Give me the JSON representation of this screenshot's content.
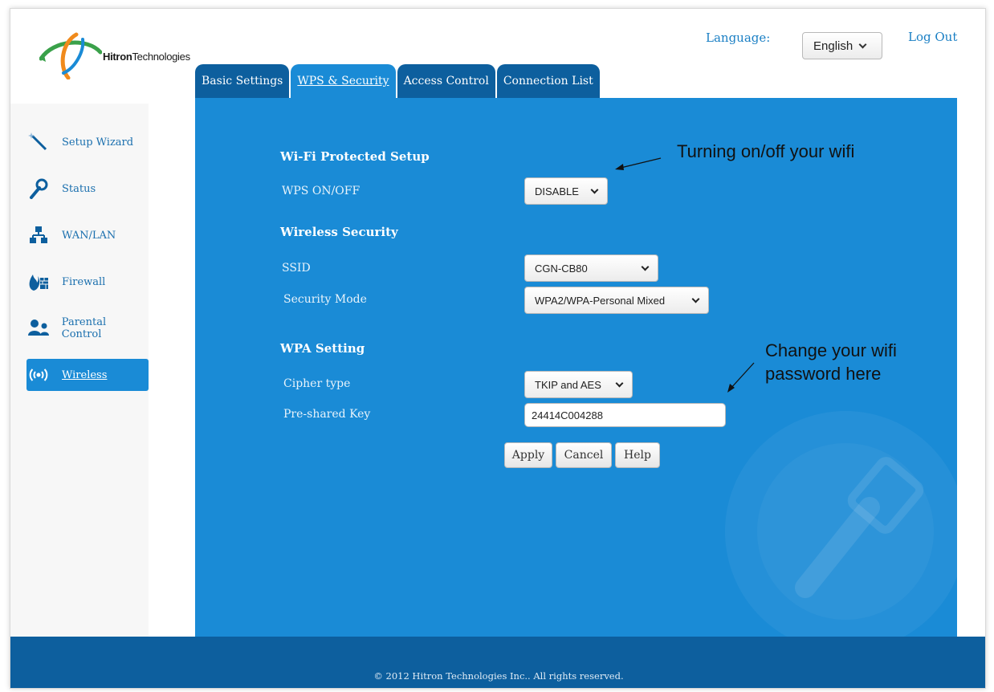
{
  "brand": {
    "name_bold": "Hitron",
    "name_rest": "Technologies",
    "colors": {
      "blue": "#1a8bd6",
      "dark_blue": "#0d5f9e",
      "orange": "#f08a1c",
      "green": "#3aa14a"
    }
  },
  "header": {
    "language_label": "Language:",
    "language_value": "English",
    "logout_label": "Log Out"
  },
  "tabs": [
    {
      "label": "Basic Settings",
      "active": false
    },
    {
      "label": "WPS & Security",
      "active": true
    },
    {
      "label": "Access Control",
      "active": false
    },
    {
      "label": "Connection List",
      "active": false
    }
  ],
  "sidebar": {
    "items": [
      {
        "label": "Setup Wizard",
        "icon": "wand-icon"
      },
      {
        "label": "Status",
        "icon": "wrench-icon"
      },
      {
        "label": "WAN/LAN",
        "icon": "network-icon"
      },
      {
        "label": "Firewall",
        "icon": "firewall-icon"
      },
      {
        "label": "Parental Control",
        "icon": "users-icon"
      },
      {
        "label": "Wireless",
        "icon": "wireless-icon",
        "active": true
      }
    ]
  },
  "wps": {
    "title": "Wi-Fi Protected Setup",
    "onoff_label": "WPS ON/OFF",
    "onoff_value": "DISABLE"
  },
  "security": {
    "title": "Wireless Security",
    "ssid_label": "SSID",
    "ssid_value": "CGN-CB80",
    "mode_label": "Security Mode",
    "mode_value": "WPA2/WPA-Personal Mixed"
  },
  "wpa": {
    "title": "WPA Setting",
    "cipher_label": "Cipher type",
    "cipher_value": "TKIP and AES",
    "psk_label": "Pre-shared Key",
    "psk_value": "24414C004288"
  },
  "buttons": {
    "apply": "Apply",
    "cancel": "Cancel",
    "help": "Help"
  },
  "annotations": {
    "wifi_toggle": "Turning on/off your wifi",
    "password_line1": "Change your wifi",
    "password_line2": "password here"
  },
  "footer": {
    "copyright": "© 2012 Hitron Technologies Inc.. All rights reserved."
  }
}
